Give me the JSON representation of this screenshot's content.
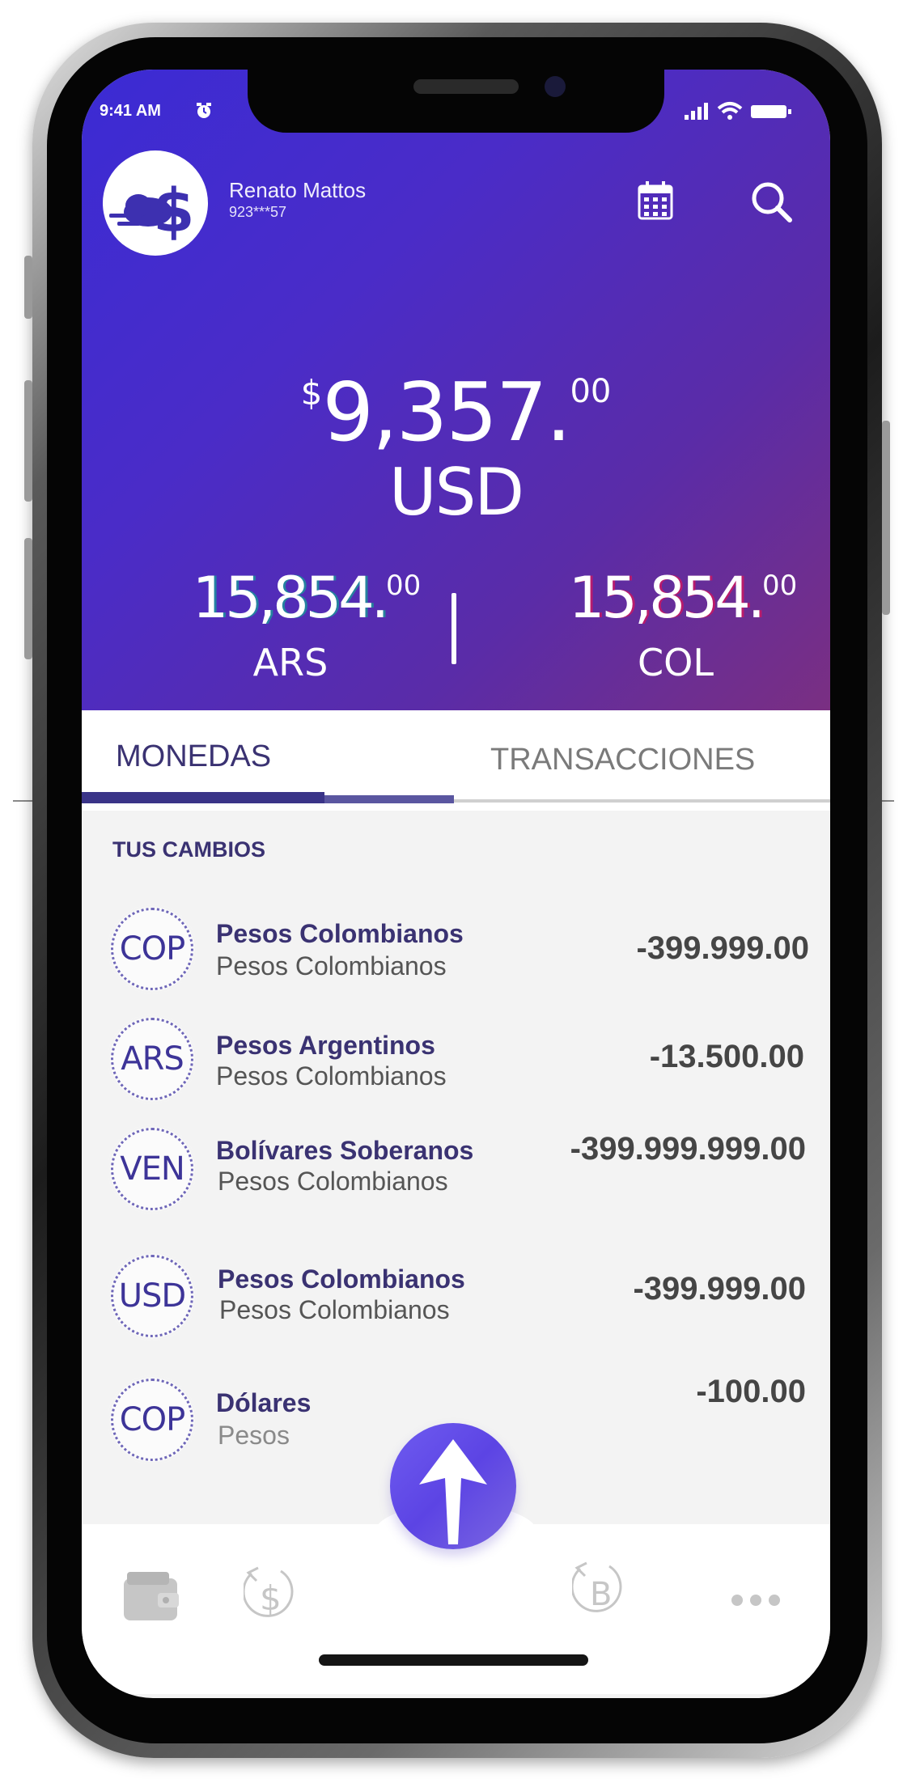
{
  "status_bar": {
    "time": "9:41 AM"
  },
  "user": {
    "name": "Renato Mattos",
    "id": "923***57"
  },
  "balance": {
    "currency_symbol": "$",
    "amount": "9,357.",
    "decimals": "00",
    "code": "USD"
  },
  "sub_balances": [
    {
      "amount": "15,854.",
      "decimals": "00",
      "code": "ARS"
    },
    {
      "amount": "15,854.",
      "decimals": "00",
      "code": "COL"
    }
  ],
  "tabs": [
    {
      "label": "MONEDAS",
      "active": true
    },
    {
      "label": "TRANSACCIONES",
      "active": false
    }
  ],
  "section_title": "TUS CAMBIOS",
  "items": [
    {
      "code": "COP",
      "name": "Pesos Colombianos",
      "sub": "Pesos Colombianos",
      "amount": "-399.999.00"
    },
    {
      "code": "ARS",
      "name": "Pesos Argentinos",
      "sub": "Pesos Colombianos",
      "amount": "-13.500.00"
    },
    {
      "code": "VEN",
      "name": "Bolívares Soberanos",
      "sub": "Pesos Colombianos",
      "amount": "-399.999.999.00"
    },
    {
      "code": "USD",
      "name": "Pesos Colombianos",
      "sub": "Pesos Colombianos",
      "amount": "-399.999.00"
    },
    {
      "code": "COP",
      "name": "Dólares",
      "sub": "Pesos",
      "amount": "-100.00"
    }
  ],
  "bottom_nav": [
    {
      "icon": "wallet-icon"
    },
    {
      "icon": "dollar-exchange-icon",
      "glyph": "$"
    },
    {
      "icon": "upload-arrow-icon"
    },
    {
      "icon": "bitcoin-exchange-icon",
      "glyph": "B"
    },
    {
      "icon": "more-icon"
    }
  ],
  "colors": {
    "header_gradient_start": "#3b2bd4",
    "header_gradient_end": "#7a2f82",
    "primary_text": "#3a3272",
    "accent": "#5c44e4"
  }
}
